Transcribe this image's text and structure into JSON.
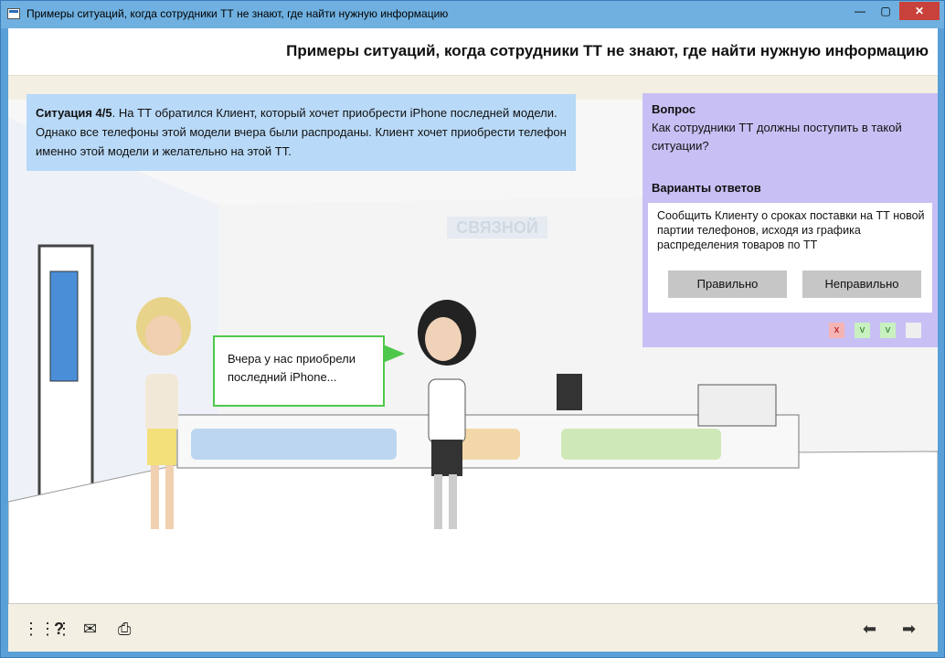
{
  "window": {
    "title": "Примеры ситуаций, когда сотрудники ТТ не знают, где найти нужную информацию",
    "close_glyph": "✕",
    "minimize_glyph": "—",
    "maximize_glyph": "▢"
  },
  "header": {
    "title": "Примеры ситуаций, когда сотрудники ТТ не знают, где найти нужную информацию"
  },
  "situation": {
    "label": "Ситуация 4/5",
    "text": ". На ТТ обратился Клиент, который хочет приобрести iPhone последней модели. Однако все телефоны этой модели вчера были распроданы. Клиент хочет приобрести телефон именно этой модели и желательно на этой ТТ."
  },
  "question": {
    "label": "Вопрос",
    "text": "Как сотрудники ТТ должны поступить в такой ситуации?",
    "answers_label": "Варианты ответов",
    "answer_text": "Сообщить Клиенту о сроках поставки на ТТ новой партии телефонов, исходя из графика распределения товаров по ТТ",
    "btn_correct": "Правильно",
    "btn_incorrect": "Неправильно",
    "progress": [
      "x",
      "v",
      "v",
      ""
    ]
  },
  "bubble": {
    "text": "Вчера у нас приобрели последний iPhone..."
  },
  "store_sign": "СВЯЗНОЙ",
  "footer": {
    "menu_icon": "⋮⋮⋮",
    "help_icon": "?",
    "mail_icon": "✉",
    "print_icon": "⎙",
    "prev_icon": "⬅",
    "next_icon": "➡"
  }
}
